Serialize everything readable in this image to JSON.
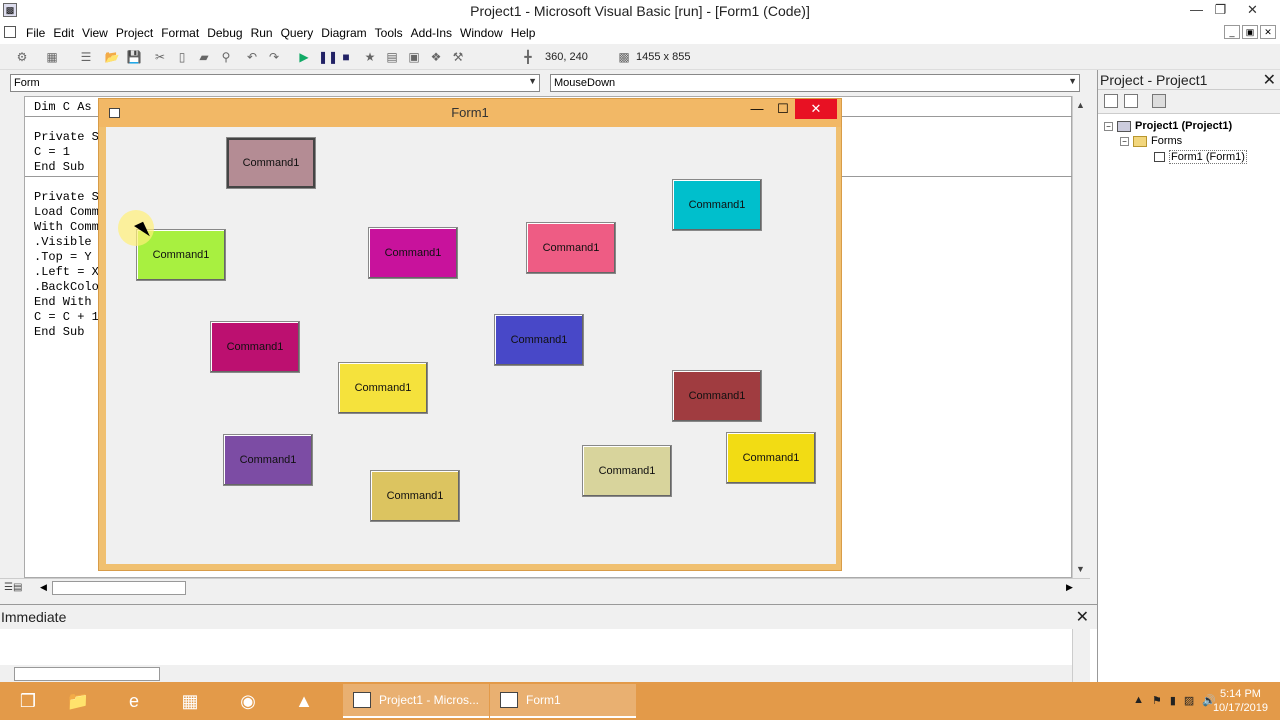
{
  "titlebar": {
    "title": "Project1 - Microsoft Visual Basic [run] - [Form1 (Code)]",
    "minimize": "—",
    "restore": "❐",
    "close": "✕"
  },
  "menu": [
    "File",
    "Edit",
    "View",
    "Project",
    "Format",
    "Debug",
    "Run",
    "Query",
    "Diagram",
    "Tools",
    "Add-Ins",
    "Window",
    "Help"
  ],
  "toolbar": {
    "position": "360, 240",
    "size": "1455 x 855"
  },
  "code": {
    "object_combo": "Form",
    "proc_combo": "MouseDown",
    "lines": [
      "Dim C As",
      "Private S",
      "C = 1",
      "End Sub",
      "Private S",
      "Load Comm",
      "With Comm",
      ".Visible",
      ".Top = Y",
      ".Left = X",
      ".BackColo",
      "End With",
      "C = C + 1",
      "End Sub"
    ]
  },
  "project": {
    "title": "Project - Project1",
    "close": "✕",
    "tree": {
      "root": "Project1 (Project1)",
      "folder": "Forms",
      "item": "Form1 (Form1)"
    }
  },
  "immediate": {
    "title": "Immediate",
    "close": "✕"
  },
  "form1": {
    "title": "Form1",
    "minimize": "—",
    "maximize": "☐",
    "close": "✕",
    "buttons": [
      {
        "label": "Command1",
        "color": "#b48c94"
      },
      {
        "label": "Command1",
        "color": "#00bfcc"
      },
      {
        "label": "Command1",
        "color": "#a8f040"
      },
      {
        "label": "Command1",
        "color": "#c8129c"
      },
      {
        "label": "Command1",
        "color": "#ee5c84"
      },
      {
        "label": "Command1",
        "color": "#bc1070"
      },
      {
        "label": "Command1",
        "color": "#4848c8"
      },
      {
        "label": "Command1",
        "color": "#f5e23c"
      },
      {
        "label": "Command1",
        "color": "#a03c40"
      },
      {
        "label": "Command1",
        "color": "#7c4ca4"
      },
      {
        "label": "Command1",
        "color": "#dcc460"
      },
      {
        "label": "Command1",
        "color": "#d8d49c"
      },
      {
        "label": "Command1",
        "color": "#f2dc14"
      }
    ]
  },
  "taskbar": {
    "tasks": [
      "Project1 - Micros...",
      "Form1"
    ],
    "time": "5:14 PM",
    "date": "10/17/2019"
  }
}
